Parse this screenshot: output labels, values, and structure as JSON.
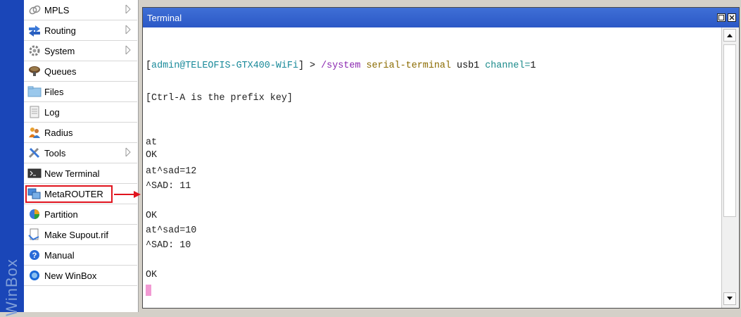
{
  "brand": {
    "text": "WinBox"
  },
  "menu": {
    "items": [
      {
        "label": "MPLS",
        "icon": "mpls-icon",
        "has_submenu": true
      },
      {
        "label": "Routing",
        "icon": "routing-icon",
        "has_submenu": true
      },
      {
        "label": "System",
        "icon": "system-gear-icon",
        "has_submenu": true
      },
      {
        "label": "Queues",
        "icon": "queues-icon",
        "has_submenu": false
      },
      {
        "label": "Files",
        "icon": "folder-icon",
        "has_submenu": false
      },
      {
        "label": "Log",
        "icon": "log-document-icon",
        "has_submenu": false
      },
      {
        "label": "Radius",
        "icon": "radius-users-icon",
        "has_submenu": false
      },
      {
        "label": "Tools",
        "icon": "tools-icon",
        "has_submenu": true
      },
      {
        "label": "New Terminal",
        "icon": "terminal-icon",
        "has_submenu": false,
        "highlighted": true
      },
      {
        "label": "MetaROUTER",
        "icon": "metarouter-icon",
        "has_submenu": false
      },
      {
        "label": "Partition",
        "icon": "partition-pie-icon",
        "has_submenu": false
      },
      {
        "label": "Make Supout.rif",
        "icon": "supout-file-icon",
        "has_submenu": false
      },
      {
        "label": "Manual",
        "icon": "help-icon",
        "has_submenu": false
      },
      {
        "label": "New WinBox",
        "icon": "winbox-globe-icon",
        "has_submenu": false
      }
    ]
  },
  "terminal": {
    "title": "Terminal",
    "prompt": {
      "open": "[",
      "user_host": "admin@TELEOFIS-GTX400-WiFi",
      "close": "] > ",
      "path": "/system",
      "command": "serial-terminal",
      "arg": "usb1",
      "param": "channel=",
      "value": "1"
    },
    "lines": {
      "prefix_note": "[Ctrl-A is the prefix key]",
      "l1": "at",
      "l2": "OK",
      "l3": "at^sad=12",
      "l4": "^SAD: 11",
      "l5": "OK",
      "l6": "at^sad=10",
      "l7": "^SAD: 10",
      "l8": "OK"
    }
  },
  "colors": {
    "accent_blue": "#2b58c6",
    "highlight_red": "#e0141e",
    "cursor_pink": "#f29ad3"
  }
}
